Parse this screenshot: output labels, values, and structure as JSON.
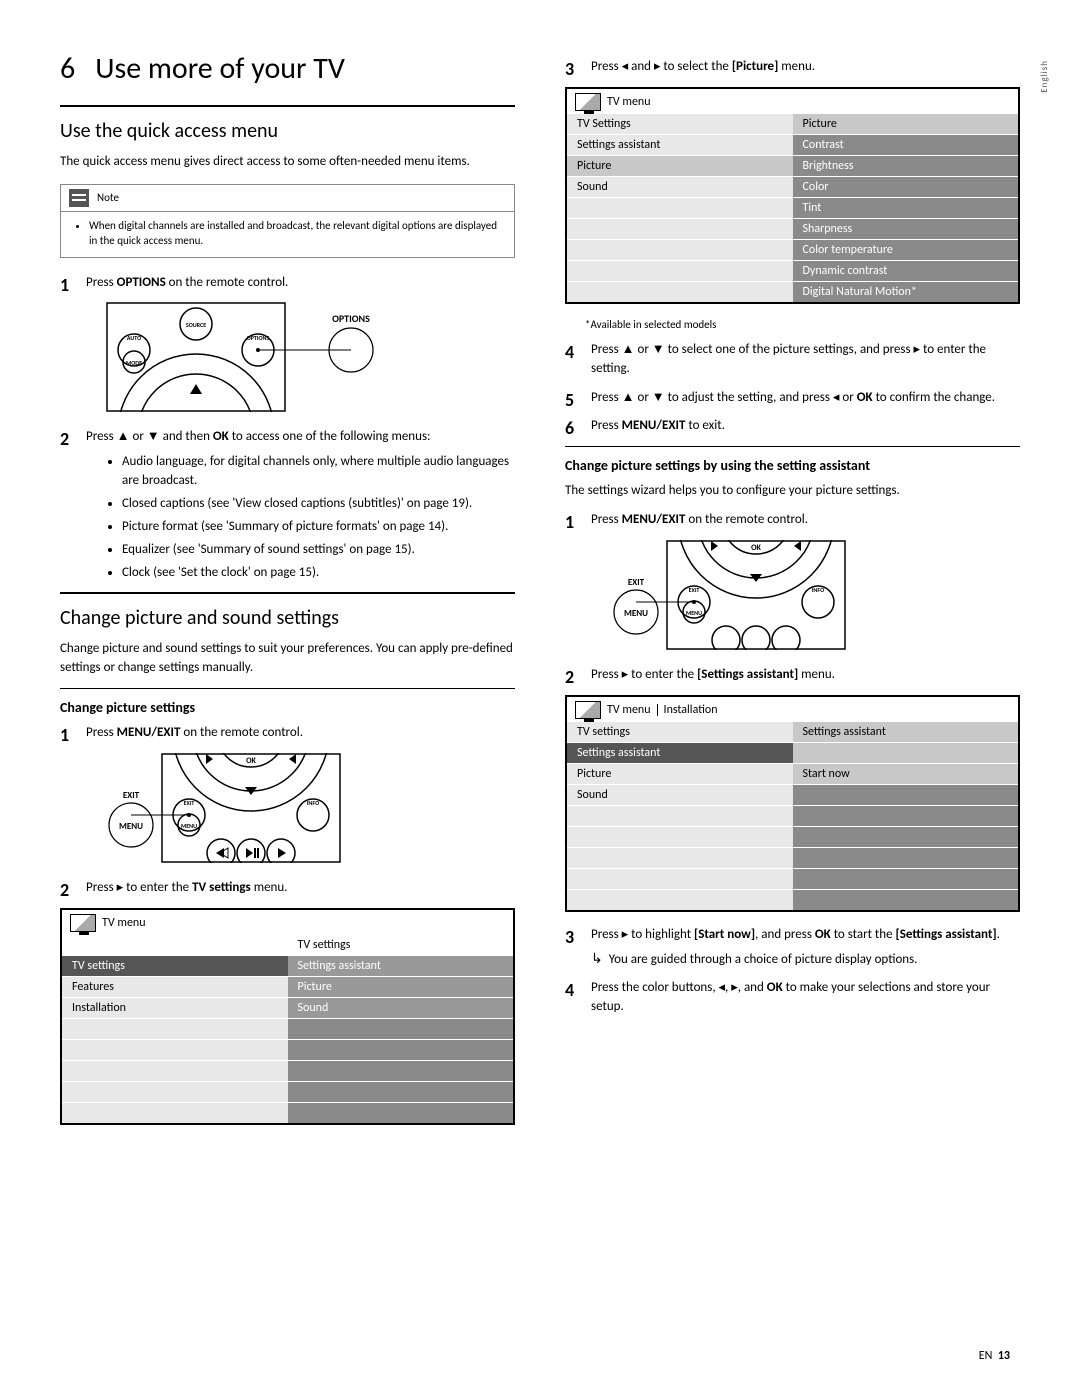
{
  "sideTab": "English",
  "chapter": {
    "num": "6",
    "title": "Use more of your TV"
  },
  "left": {
    "sec1": {
      "heading": "Use the quick access menu",
      "intro": "The quick access menu gives direct access to some often-needed menu items.",
      "noteLabel": "Note",
      "noteItem": "When digital channels are installed and broadcast, the relevant digital options are displayed in the quick access menu.",
      "step1a": "Press ",
      "step1b": "OPTIONS",
      "step1c": " on the remote control.",
      "step2a": "Press ▲ or ▼ and then ",
      "step2b": "OK",
      "step2c": " to access one of the following menus:",
      "bullets": [
        "Audio language, for digital channels only, where multiple audio languages are broadcast.",
        "Closed captions (see 'View closed captions (subtitles)' on page 19).",
        "Picture format (see 'Summary of picture formats' on page 14).",
        "Equalizer (see 'Summary of sound settings' on page 15).",
        "Clock (see 'Set the clock' on page 15)."
      ]
    },
    "sec2": {
      "heading": "Change picture and sound settings",
      "intro": "Change picture and sound settings to suit your preferences. You can apply pre-defined settings or change settings manually.",
      "sub": "Change picture settings",
      "step1a": "Press ",
      "step1b": "MENU/EXIT",
      "step1c": " on the remote control.",
      "step2a": "Press ▸ to enter the ",
      "step2b": "TV settings",
      "step2c": " menu.",
      "table": {
        "crumb1": "TV menu",
        "headerR": "TV settings",
        "rows": [
          {
            "l": "TV settings",
            "lcls": "left-hi",
            "r": "Settings assistant",
            "rcls": "right-med"
          },
          {
            "l": "Features",
            "lcls": "left-light",
            "r": "Picture",
            "rcls": "right-med"
          },
          {
            "l": "Installation",
            "lcls": "left-light",
            "r": "Sound",
            "rcls": "right-med"
          },
          {
            "l": "",
            "lcls": "left-light",
            "r": "",
            "rcls": "blank-dark"
          },
          {
            "l": "",
            "lcls": "left-light",
            "r": "",
            "rcls": "blank-dark"
          },
          {
            "l": "",
            "lcls": "left-light",
            "r": "",
            "rcls": "blank-dark"
          },
          {
            "l": "",
            "lcls": "left-light",
            "r": "",
            "rcls": "blank-dark"
          },
          {
            "l": "",
            "lcls": "left-light",
            "r": "",
            "rcls": "blank-dark"
          }
        ]
      }
    }
  },
  "right": {
    "step3a": "Press ◂ and ▸ to select the ",
    "step3b": "[Picture]",
    "step3c": " menu.",
    "table1": {
      "crumb1": "TV menu",
      "rows": [
        {
          "l": "TV Settings",
          "lcls": "left-light",
          "r": "Picture",
          "rcls": "right-light"
        },
        {
          "l": "Settings assistant",
          "lcls": "left-light",
          "r": "Contrast",
          "rcls": "right-dark"
        },
        {
          "l": "Picture",
          "lcls": "left-sel",
          "r": "Brightness",
          "rcls": "right-dark"
        },
        {
          "l": "Sound",
          "lcls": "left-light",
          "r": "Color",
          "rcls": "right-dark"
        },
        {
          "l": "",
          "lcls": "left-light",
          "r": "Tint",
          "rcls": "right-dark"
        },
        {
          "l": "",
          "lcls": "left-light",
          "r": "Sharpness",
          "rcls": "right-dark"
        },
        {
          "l": "",
          "lcls": "left-light",
          "r": "Color temperature",
          "rcls": "right-dark"
        },
        {
          "l": "",
          "lcls": "left-light",
          "r": "Dynamic contrast",
          "rcls": "right-dark"
        },
        {
          "l": "",
          "lcls": "left-light",
          "r": "Digital Natural Motion*",
          "rcls": "right-dark"
        }
      ]
    },
    "footnote": "*Available in selected models",
    "step4": "Press ▲ or ▼ to select one of the picture settings, and press ▸ to enter the setting.",
    "step5a": "Press ▲ or ▼ to adjust the setting, and press ◂ or ",
    "step5b": "OK",
    "step5c": " to confirm the change.",
    "step6a": "Press ",
    "step6b": "MENU/EXIT",
    "step6c": " to exit.",
    "sub2": "Change picture settings by using the setting assistant",
    "p2": "The settings wizard helps you to configure your picture settings.",
    "as_step1a": "Press ",
    "as_step1b": "MENU/EXIT",
    "as_step1c": " on the remote control.",
    "as_step2a": "Press ▸ to enter the ",
    "as_step2b": "[Settings assistant]",
    "as_step2c": " menu.",
    "table2": {
      "crumb1": "TV menu",
      "crumb2": "Installation",
      "rows": [
        {
          "l": "TV settings",
          "lcls": "left-light",
          "r": "Settings assistant",
          "rcls": "right-light"
        },
        {
          "l": "Settings assistant",
          "lcls": "left-hi",
          "r": "",
          "rcls": "right-light"
        },
        {
          "l": "Picture",
          "lcls": "left-light",
          "r": "Start now",
          "rcls": "right-light"
        },
        {
          "l": "Sound",
          "lcls": "left-light",
          "r": "",
          "rcls": "blank-dark"
        },
        {
          "l": "",
          "lcls": "left-light",
          "r": "",
          "rcls": "blank-dark"
        },
        {
          "l": "",
          "lcls": "left-light",
          "r": "",
          "rcls": "blank-dark"
        },
        {
          "l": "",
          "lcls": "left-light",
          "r": "",
          "rcls": "blank-dark"
        },
        {
          "l": "",
          "lcls": "left-light",
          "r": "",
          "rcls": "blank-dark"
        },
        {
          "l": "",
          "lcls": "left-light",
          "r": "",
          "rcls": "blank-dark"
        }
      ]
    },
    "as_step3a": "Press ▸ to highlight ",
    "as_step3b": "[Start now]",
    "as_step3c": ", and press ",
    "as_step3d": "OK",
    "as_step3e": " to start the ",
    "as_step3f": "[Settings assistant]",
    "as_step3g": ".",
    "as_result": "You are guided through a choice of picture display options.",
    "as_step4a": "Press the color buttons, ◂, ▸, and ",
    "as_step4b": "OK",
    "as_step4c": " to make your selections and store your setup."
  },
  "footer": {
    "lang": "EN",
    "page": "13"
  },
  "remote": {
    "options": "OPTIONS",
    "source": "SOURCE",
    "auto": "AUTO",
    "mode": "MODE",
    "optionsSmall": "OPTIONS",
    "ok": "OK",
    "exit": "EXIT",
    "menu": "MENU",
    "exitSmall": "EXIT",
    "menuSmall": "MENU",
    "info": "INFO"
  }
}
